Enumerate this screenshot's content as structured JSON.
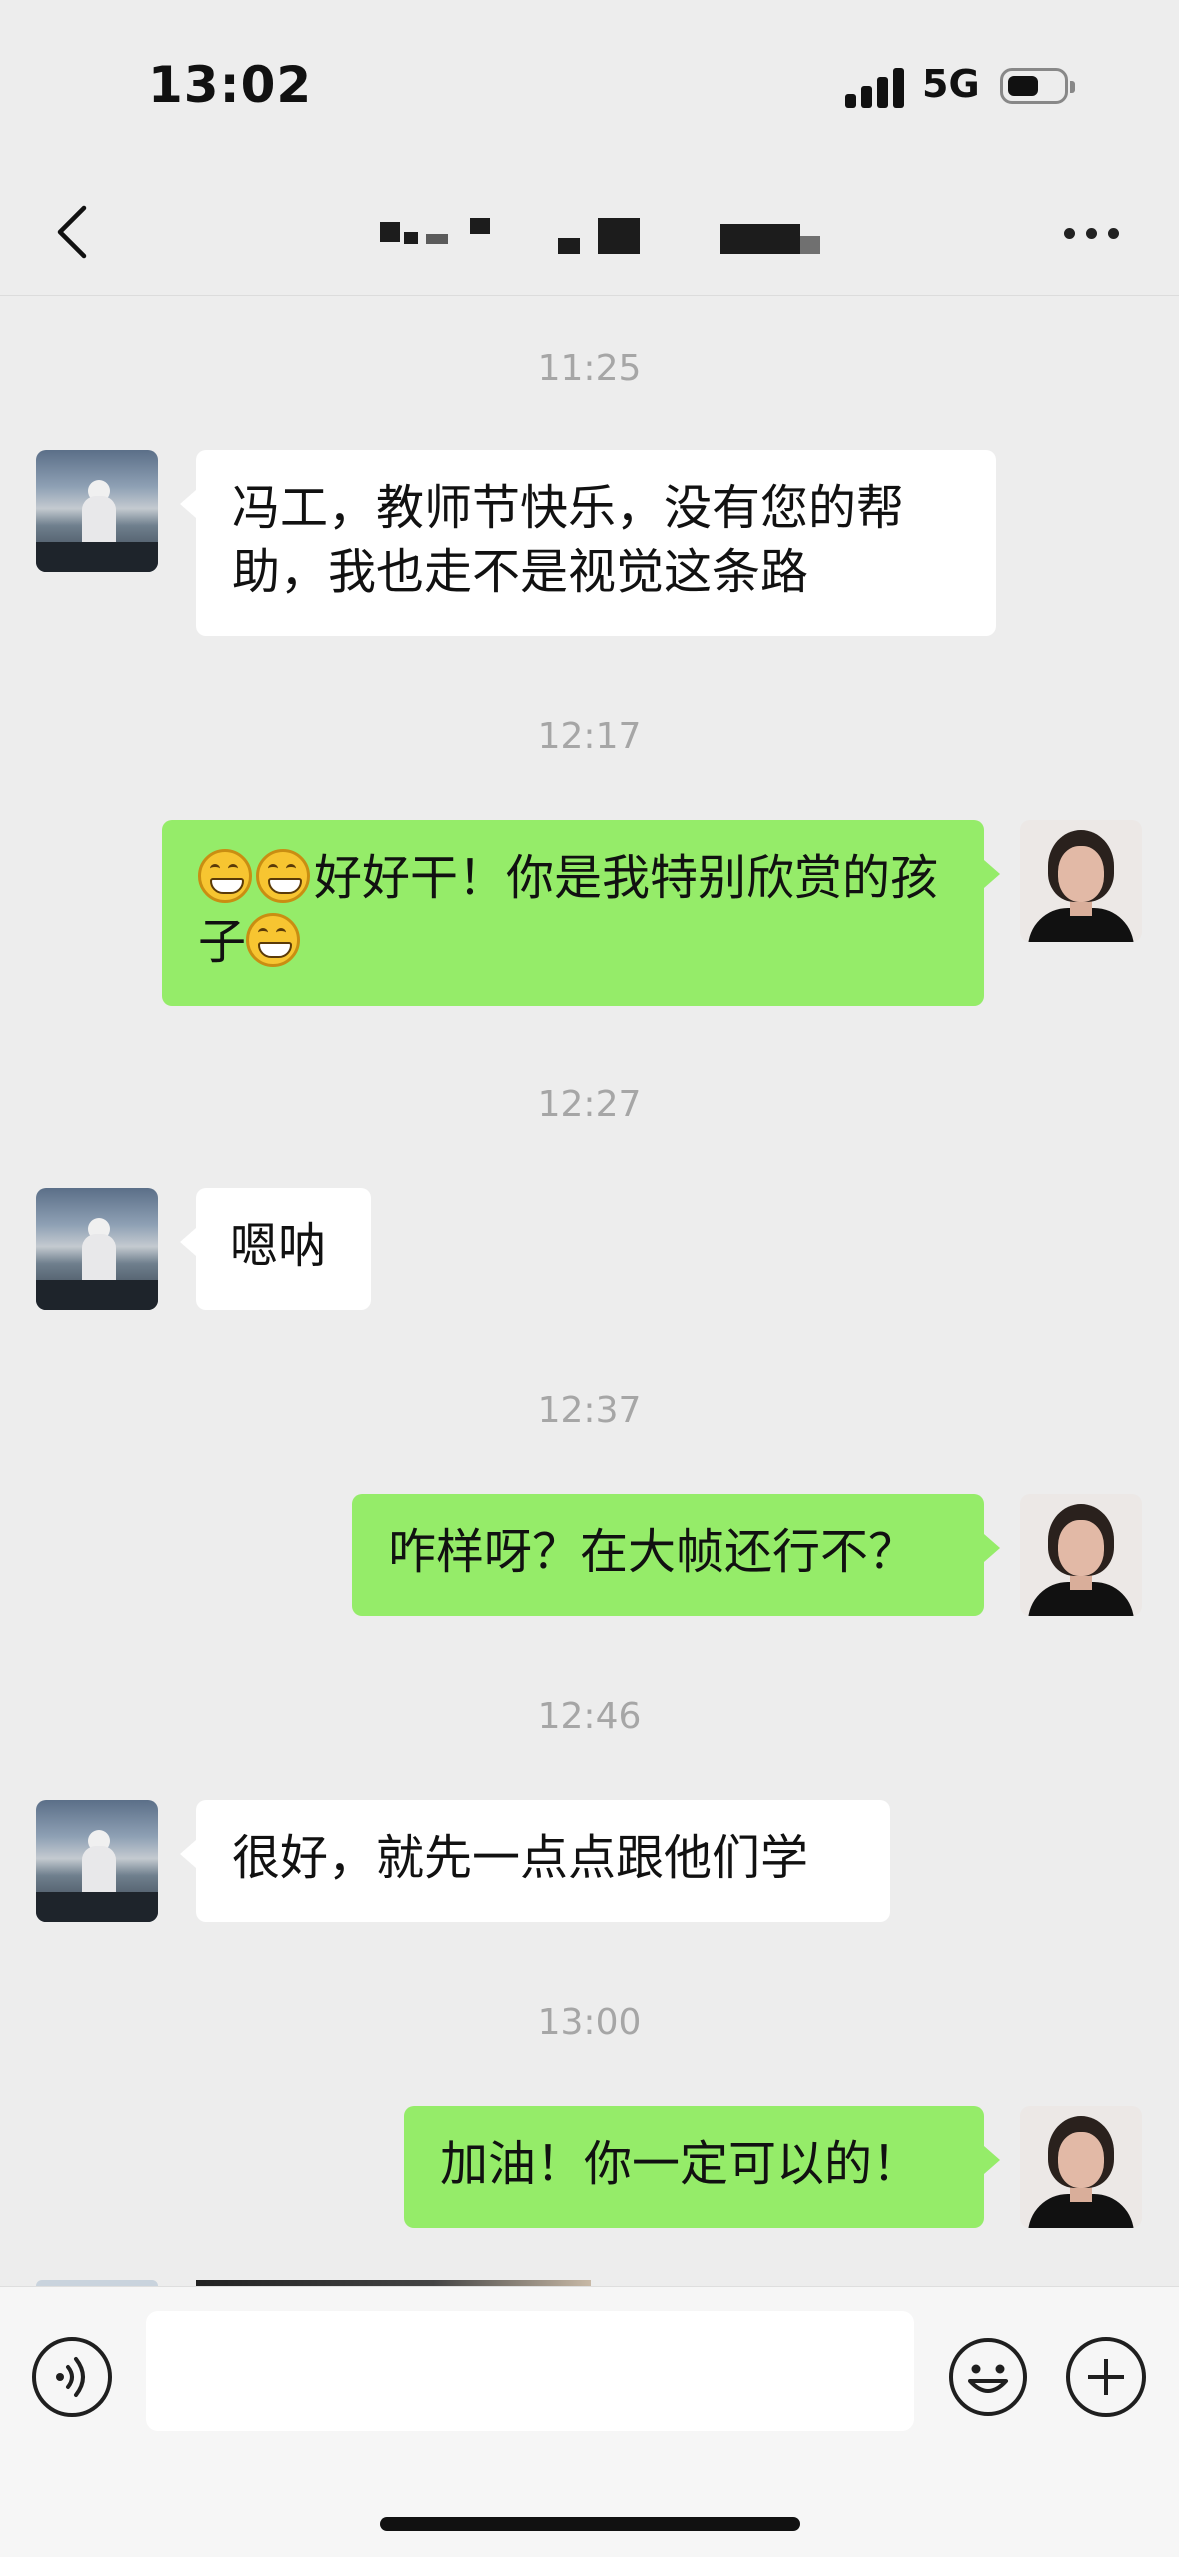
{
  "status_bar": {
    "time": "13:02",
    "network": "5G",
    "battery_level": 0.45
  },
  "nav": {
    "title": "",
    "back_icon": "chevron-left-icon",
    "more_icon": "ellipsis-icon"
  },
  "messages": [
    {
      "time": "11:25",
      "direction": "in",
      "text": "冯工，教师节快乐，没有您的帮助，我也走不是视觉这条路"
    },
    {
      "time": "12:17",
      "direction": "out",
      "text": "好好干！你是我特别欣赏的孩子",
      "emoji": "grin-emoji"
    },
    {
      "time": "12:27",
      "direction": "in",
      "text": "嗯呐"
    },
    {
      "time": "12:37",
      "direction": "out",
      "text": "咋样呀？在大帧还行不？"
    },
    {
      "time": "12:46",
      "direction": "in",
      "text": "很好，就先一点点跟他们学"
    },
    {
      "time": "13:00",
      "direction": "out",
      "text": "加油！你一定可以的！"
    }
  ],
  "input_bar": {
    "voice_icon": "voice-icon",
    "input_value": "",
    "emoji_icon": "smiley-icon",
    "plus_icon": "plus-icon"
  }
}
